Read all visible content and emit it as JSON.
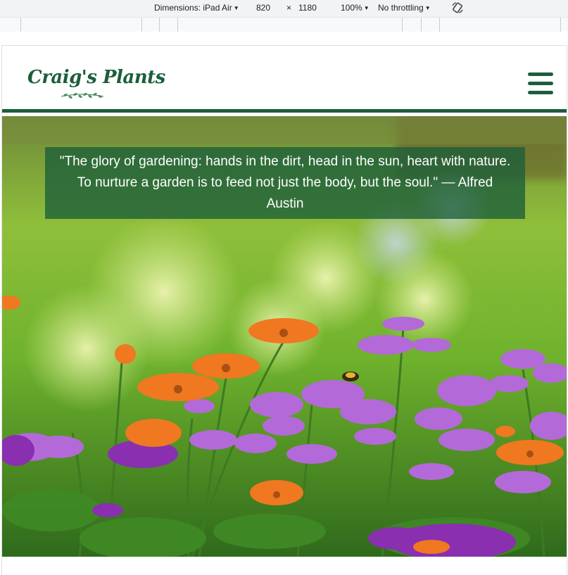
{
  "devtools": {
    "dimensions_label": "Dimensions: iPad Air",
    "width": "820",
    "times": "×",
    "height": "1180",
    "zoom": "100%",
    "throttling": "No throttling",
    "rotate_icon": "rotate-icon"
  },
  "site": {
    "logo_text": "Craig's Plants",
    "menu_icon": "hamburger-menu-icon",
    "brand_color": "#1b5e3a"
  },
  "hero": {
    "quote": "\"The glory of gardening: hands in the dirt, head in the sun, heart with nature. To nurture a garden is to feed not just the body, but the soul.\" — Alfred Austin"
  }
}
